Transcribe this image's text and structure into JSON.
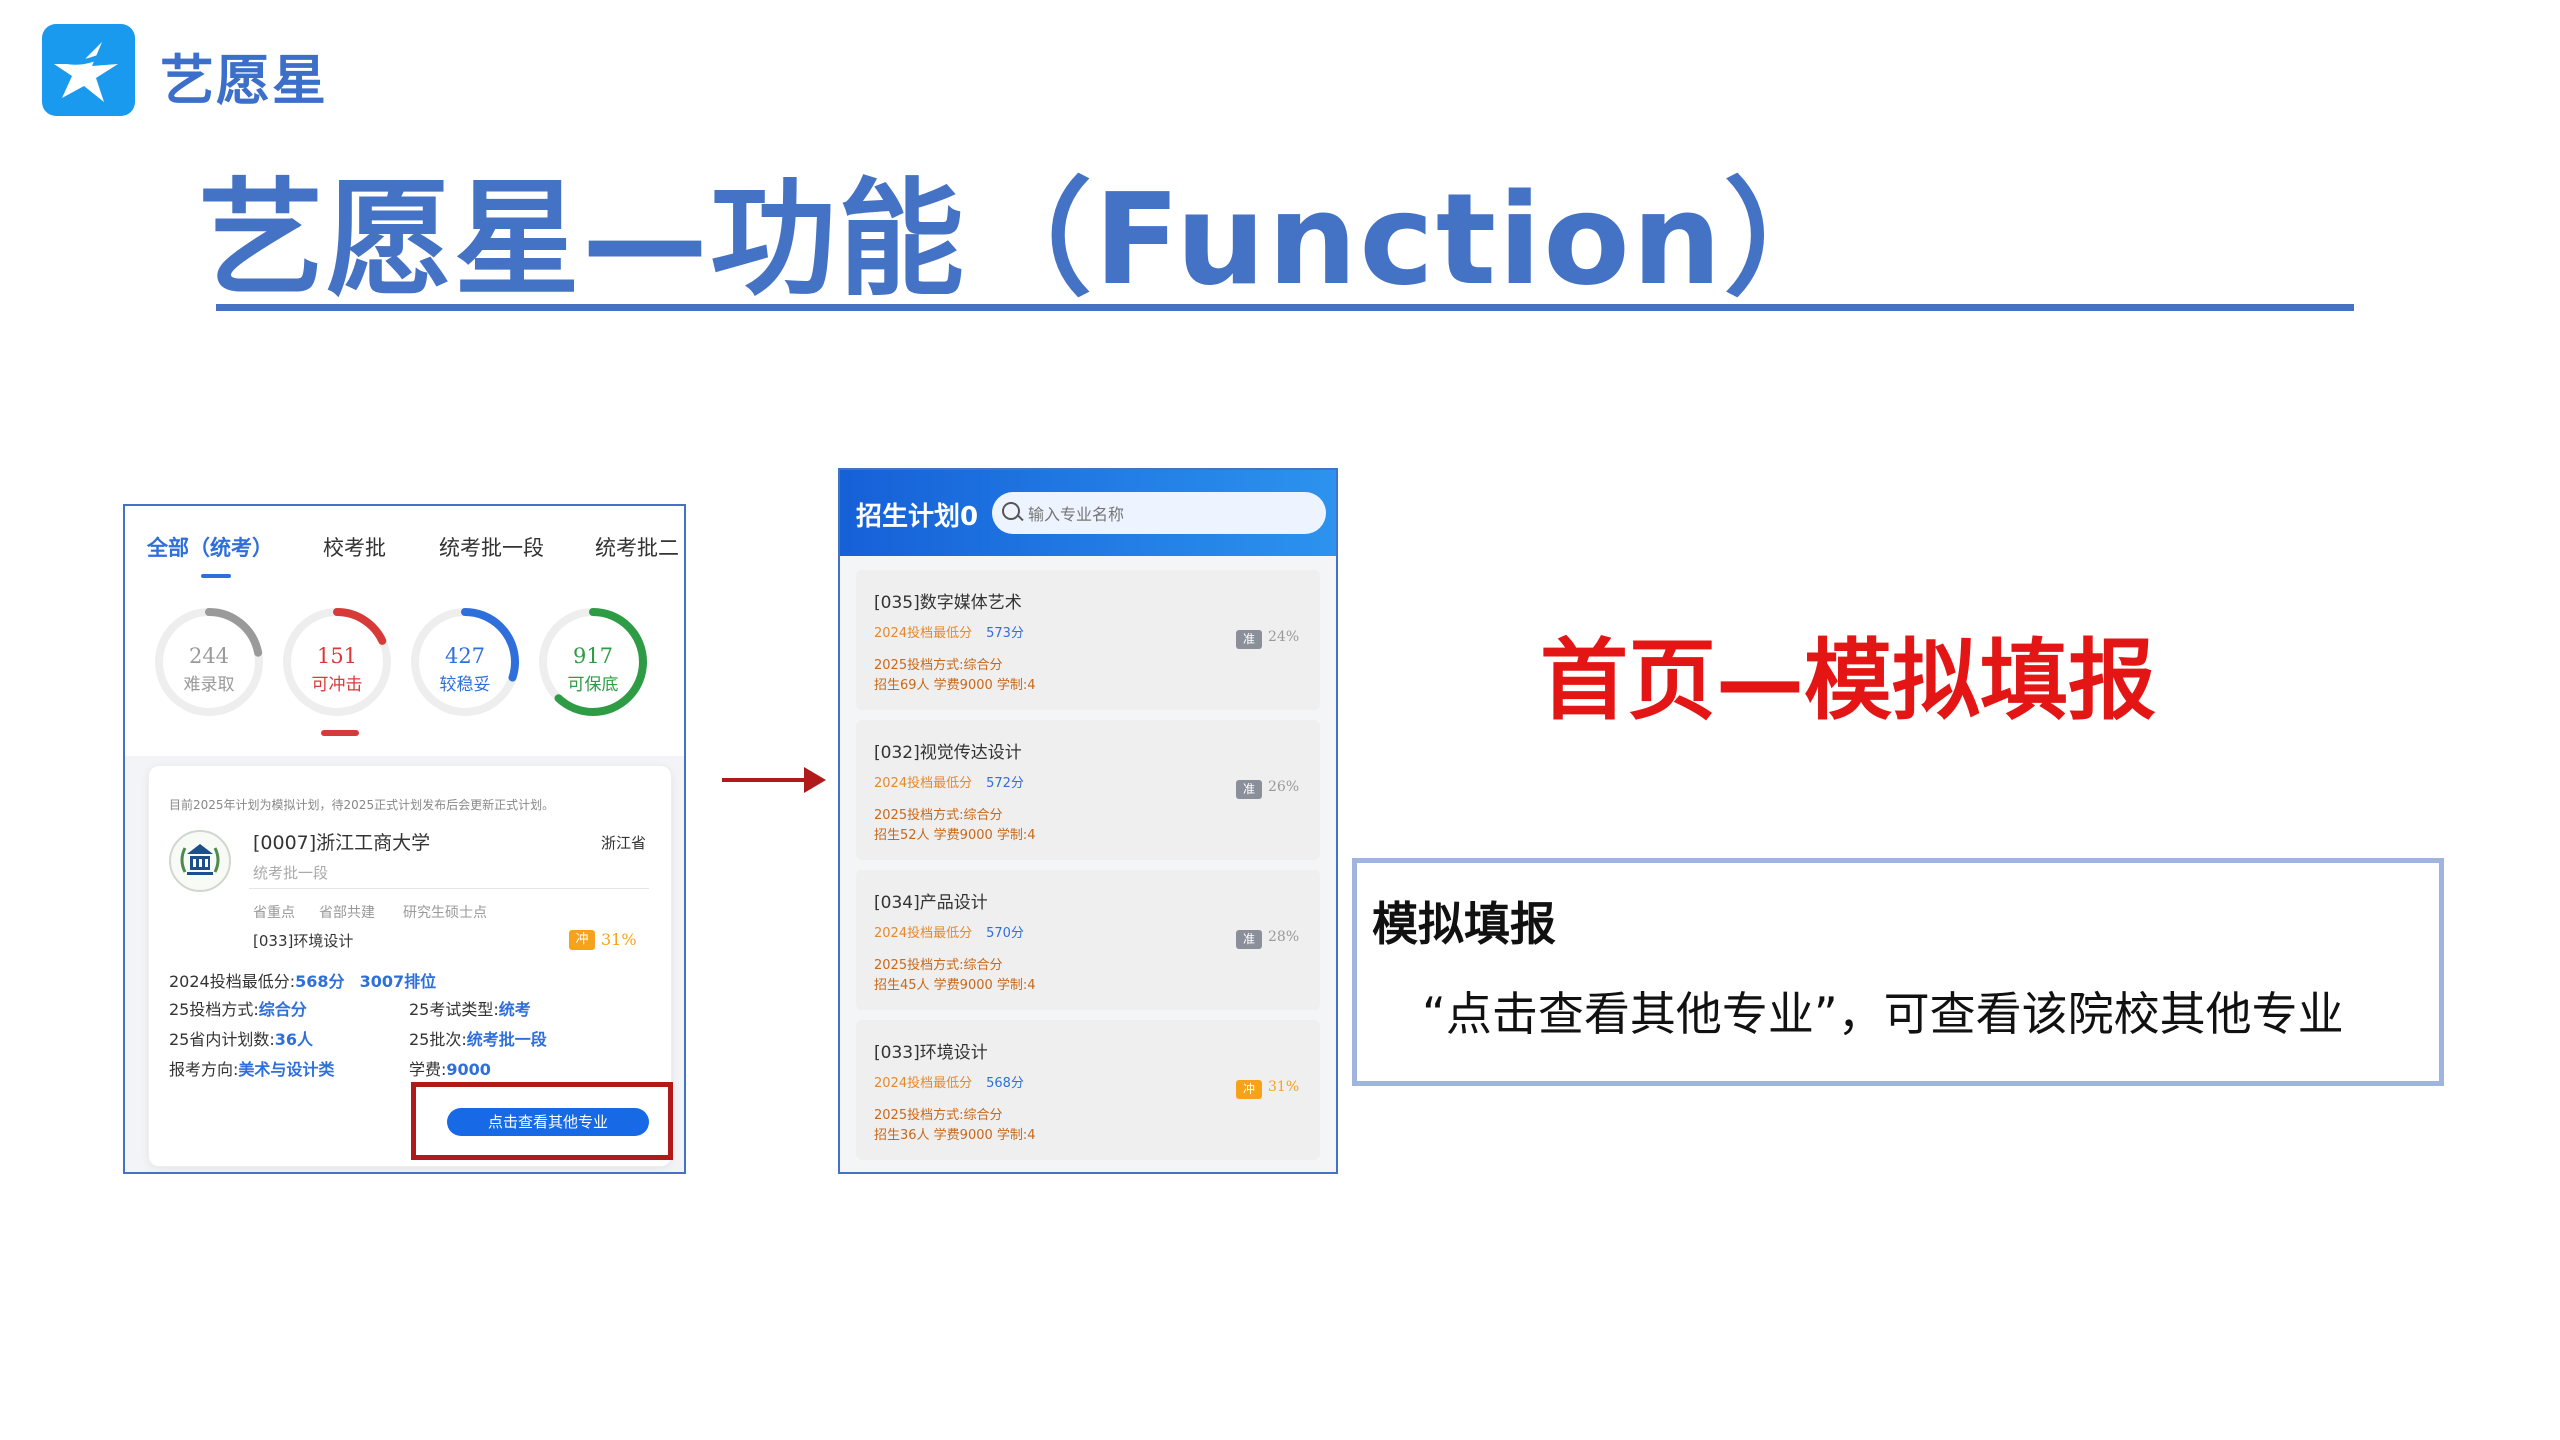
{
  "header": {
    "logo_text": "艺愿星",
    "title": "艺愿星—功能（Function）"
  },
  "panel1": {
    "tabs": [
      "全部（统考）",
      "校考批",
      "统考批一段",
      "统考批二"
    ],
    "rings": [
      {
        "value": "244",
        "label": "难录取",
        "color": "#9a9a9a",
        "fraction": 0.22
      },
      {
        "value": "151",
        "label": "可冲击",
        "color": "#d83a3a",
        "fraction": 0.18
      },
      {
        "value": "427",
        "label": "较稳妥",
        "color": "#2f6fdc",
        "fraction": 0.3
      },
      {
        "value": "917",
        "label": "可保底",
        "color": "#2e9b45",
        "fraction": 0.62
      }
    ],
    "notice": "目前2025年计划为模拟计划，待2025正式计划发布后会更新正式计划。",
    "university": "[0007]浙江工商大学",
    "province": "浙江省",
    "batch": "统考批一段",
    "tags": [
      "省重点",
      "省部共建",
      "研究生硕士点"
    ],
    "major": "[033]环境设计",
    "chance_badge": "冲",
    "chance_pct": "31%",
    "details": {
      "min_score_label": "2024投档最低分:",
      "min_score": "568分",
      "rank": "3007排位",
      "mode_label": "25投档方式:",
      "mode": "综合分",
      "exam_label": "25考试类型:",
      "exam": "统考",
      "plan_label": "25省内计划数:",
      "plan": "36人",
      "batch_label": "25批次:",
      "batch": "统考批一段",
      "direction_label": "报考方向:",
      "direction": "美术与设计类",
      "fee_label": "学费:",
      "fee": "9000"
    },
    "view_button": "点击查看其他专业"
  },
  "panel2": {
    "title": "招生计划0",
    "search_placeholder": "输入专业名称",
    "majors": [
      {
        "name": "[035]数字媒体艺术",
        "line1_label": "2024投档最低分",
        "line1_val": "573分",
        "line2": "2025投档方式:综合分",
        "line3": "招生69人   学费9000   学制:4",
        "badge": "准",
        "badge_color": "#8a8f99",
        "pct": "24%",
        "pct_color": "#9a9a9a"
      },
      {
        "name": "[032]视觉传达设计",
        "line1_label": "2024投档最低分",
        "line1_val": "572分",
        "line2": "2025投档方式:综合分",
        "line3": "招生52人   学费9000   学制:4",
        "badge": "准",
        "badge_color": "#8a8f99",
        "pct": "26%",
        "pct_color": "#9a9a9a"
      },
      {
        "name": "[034]产品设计",
        "line1_label": "2024投档最低分",
        "line1_val": "570分",
        "line2": "2025投档方式:综合分",
        "line3": "招生45人   学费9000   学制:4",
        "badge": "准",
        "badge_color": "#8a8f99",
        "pct": "28%",
        "pct_color": "#9a9a9a"
      },
      {
        "name": "[033]环境设计",
        "line1_label": "2024投档最低分",
        "line1_val": "568分",
        "line2": "2025投档方式:综合分",
        "line3": "招生36人   学费9000   学制:4",
        "badge": "冲",
        "badge_color": "#f7a21b",
        "pct": "31%",
        "pct_color": "#f7a21b"
      }
    ]
  },
  "right": {
    "subtitle": "首页—模拟填报",
    "info_title": "模拟填报",
    "info_desc": "“点击查看其他专业”，可查看该院校其他专业"
  }
}
